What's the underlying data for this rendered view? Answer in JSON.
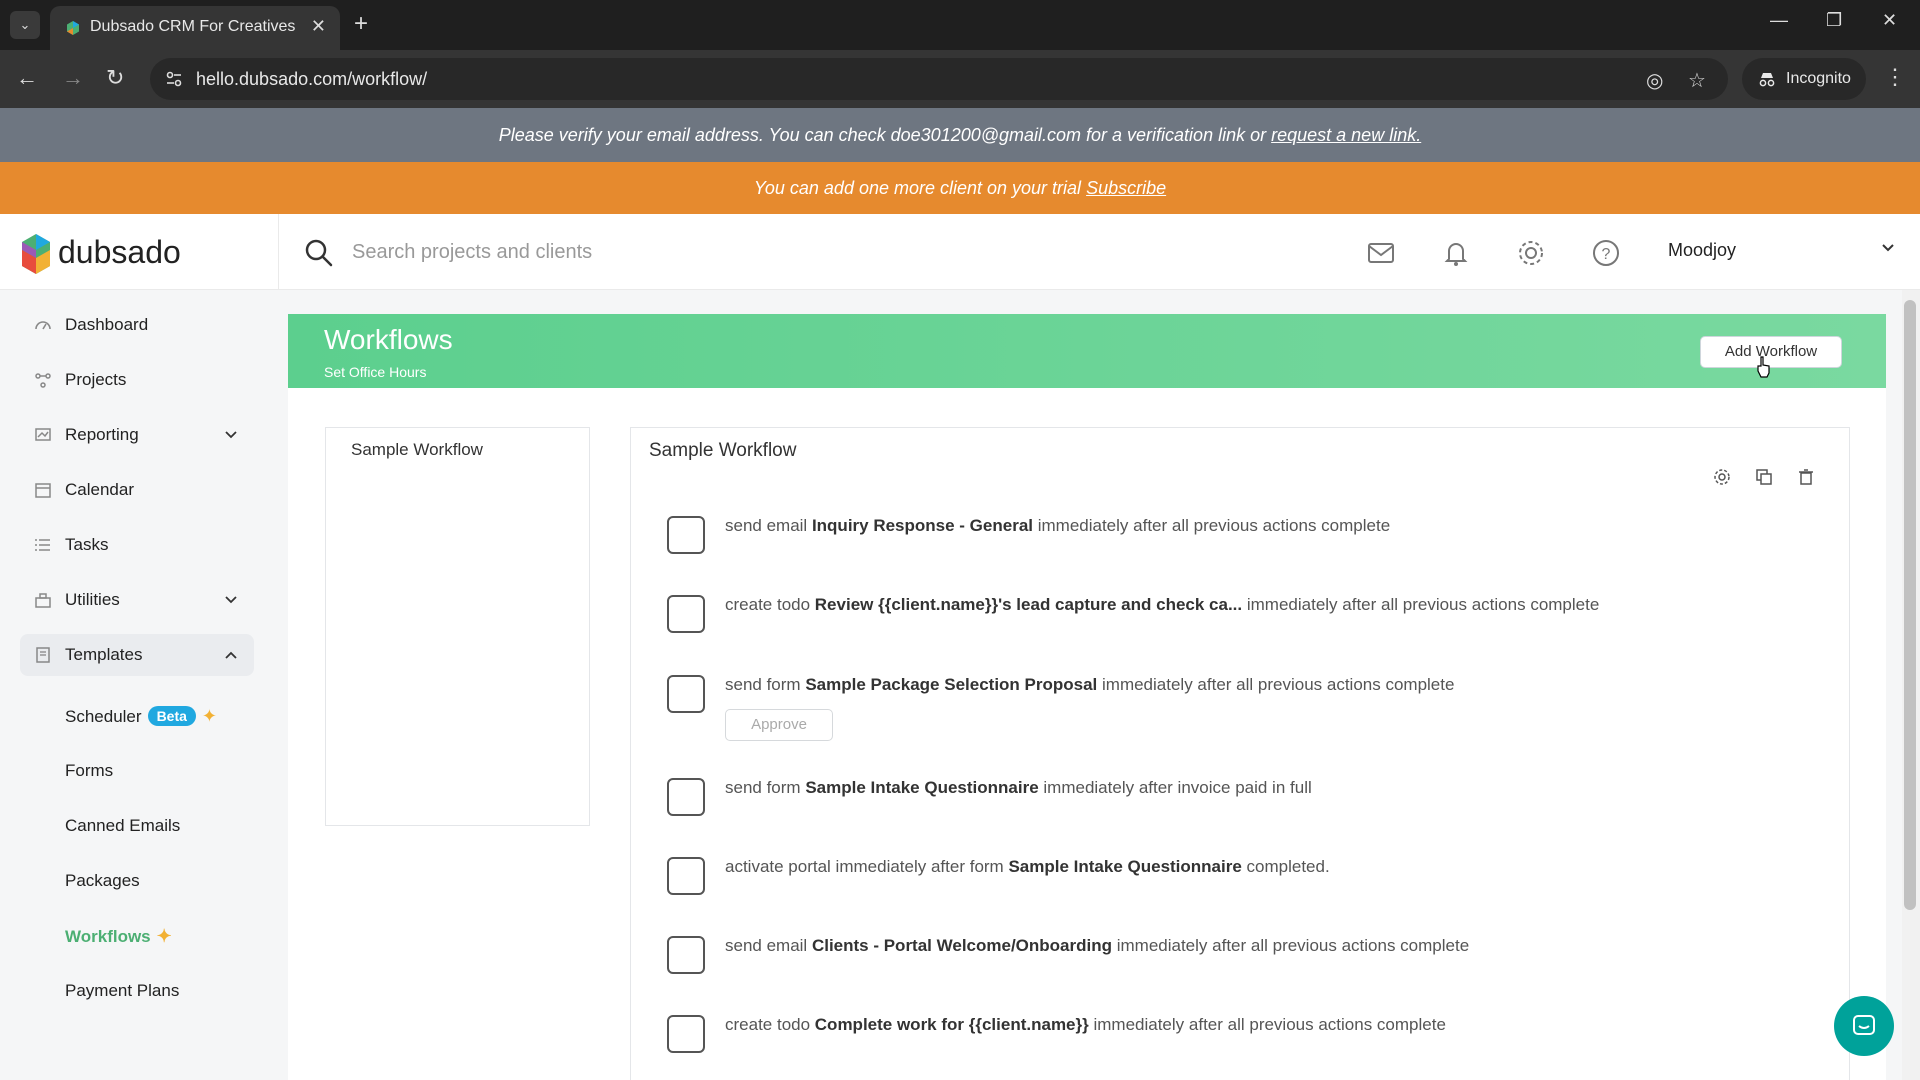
{
  "browser": {
    "tab_title": "Dubsado CRM For Creatives",
    "url": "hello.dubsado.com/workflow/",
    "incognito_label": "Incognito"
  },
  "banners": {
    "verify_text": "Please verify your email address. You can check doe301200@gmail.com for a verification link or",
    "verify_link": "request a new link.",
    "trial_text": "You can add one more client on your trial",
    "trial_link": "Subscribe"
  },
  "header": {
    "logo": "dubsado",
    "search_placeholder": "Search projects and clients",
    "user_name": "Moodjoy"
  },
  "sidebar": {
    "items": [
      {
        "label": "Dashboard",
        "icon": "dashboard-icon"
      },
      {
        "label": "Projects",
        "icon": "projects-icon"
      },
      {
        "label": "Reporting",
        "icon": "reporting-icon"
      },
      {
        "label": "Calendar",
        "icon": "calendar-icon"
      },
      {
        "label": "Tasks",
        "icon": "tasks-icon"
      },
      {
        "label": "Utilities",
        "icon": "utilities-icon"
      },
      {
        "label": "Templates",
        "icon": "templates-icon"
      }
    ],
    "sub_items": [
      {
        "label": "Scheduler",
        "badge": "Beta"
      },
      {
        "label": "Forms"
      },
      {
        "label": "Canned Emails"
      },
      {
        "label": "Packages"
      },
      {
        "label": "Workflows"
      },
      {
        "label": "Payment Plans"
      }
    ]
  },
  "page": {
    "title": "Workflows",
    "subtitle": "Set Office Hours",
    "add_button": "Add Workflow"
  },
  "workflow_list": [
    "Sample Workflow"
  ],
  "workflow": {
    "title": "Sample Workflow",
    "steps": [
      {
        "pre": "send email ",
        "bold": "Inquiry Response - General",
        "post": " immediately after all previous actions complete"
      },
      {
        "pre": "create todo ",
        "bold": "Review {{client.name}}'s lead capture and check ca...",
        "post": " immediately after all previous actions complete"
      },
      {
        "pre": "send form ",
        "bold": "Sample Package Selection Proposal",
        "post": " immediately after all previous actions complete",
        "button": "Approve"
      },
      {
        "pre": "send form ",
        "bold": "Sample Intake Questionnaire",
        "post": " immediately after invoice paid in full"
      },
      {
        "pre": "activate portal immediately after form ",
        "bold": "Sample Intake Questionnaire",
        "post": " completed."
      },
      {
        "pre": "send email ",
        "bold": "Clients - Portal Welcome/Onboarding",
        "post": " immediately after all previous actions complete"
      },
      {
        "pre": "create todo ",
        "bold": "Complete work for {{client.name}}",
        "post": " immediately after all previous actions complete"
      }
    ]
  },
  "colors": {
    "accent_green": "#5ccf8e",
    "trial_orange": "#e68a2e",
    "verify_gray": "#6e7681",
    "active_green": "#4caf73",
    "beta_blue": "#20a8e0"
  }
}
